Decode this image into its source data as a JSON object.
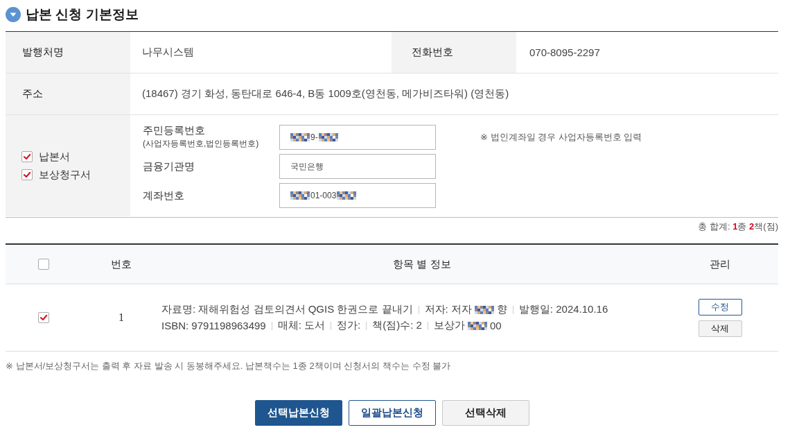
{
  "section": {
    "title": "납본 신청 기본정보"
  },
  "info_table": {
    "publisher_label": "발행처명",
    "publisher": "나무시스템",
    "phone_label": "전화번호",
    "phone": "070-8095-2297",
    "address_label": "주소",
    "address": "(18467) 경기 화성, 동탄대로 646-4, B동 1009호(영천동, 메가비즈타워) (영천동)",
    "documents": [
      {
        "label": "납본서",
        "checked": true
      },
      {
        "label": "보상청구서",
        "checked": true
      }
    ],
    "fields": [
      {
        "label": "주민등록번호",
        "sublabel": "(사업자등록번호,법인등록번호)",
        "value_parts": [
          {
            "kind": "masked"
          },
          {
            "kind": "text",
            "text": "9-"
          },
          {
            "kind": "masked"
          }
        ]
      },
      {
        "label": "금융기관명",
        "value_parts": [
          {
            "kind": "text",
            "text": "국민은행"
          }
        ]
      },
      {
        "label": "계좌번호",
        "value_parts": [
          {
            "kind": "masked"
          },
          {
            "kind": "text",
            "text": "01-003"
          },
          {
            "kind": "masked"
          }
        ]
      }
    ],
    "note": "※ 법인계좌일 경우 사업자등록번호 입력"
  },
  "total": "총 합계: **1**종 **2**책(점)",
  "items_table": {
    "columns": [
      {
        "kind": "checkbox",
        "checked": false
      },
      {
        "kind": "text",
        "label": "번호"
      },
      {
        "kind": "text",
        "label": "항목 별 정보"
      },
      {
        "kind": "text",
        "label": "관리"
      }
    ],
    "rows": [
      {
        "checked": true,
        "number": "1",
        "info_lines": [
          [
            {
              "parts": [
                {
                  "kind": "text",
                  "text": "자료명: 재해위험성 검토의견서 QGIS 한권으로 끝내기"
                }
              ]
            },
            {
              "parts": [
                {
                  "kind": "text",
                  "text": "저자: 저자"
                },
                {
                  "kind": "masked"
                },
                {
                  "kind": "text",
                  "text": "향"
                }
              ]
            },
            {
              "parts": [
                {
                  "kind": "text",
                  "text": "발행일: 2024.10.16"
                }
              ]
            }
          ],
          [
            {
              "parts": [
                {
                  "kind": "text",
                  "text": "ISBN: 9791198963499"
                }
              ]
            },
            {
              "parts": [
                {
                  "kind": "text",
                  "text": "매체: 도서"
                }
              ]
            },
            {
              "parts": [
                {
                  "kind": "text",
                  "text": "정가:"
                }
              ]
            },
            {
              "parts": [
                {
                  "kind": "text",
                  "text": "책(점)수: 2"
                }
              ]
            },
            {
              "parts": [
                {
                  "kind": "text",
                  "text": "보상가"
                },
                {
                  "kind": "masked"
                },
                {
                  "kind": "text",
                  "text": "00"
                }
              ]
            }
          ]
        ],
        "actions": [
          {
            "label": "수정",
            "kind": "outline"
          },
          {
            "label": "삭제",
            "kind": "gray"
          }
        ]
      }
    ]
  },
  "footnote": "※ 납본서/보상청구서는 출력 후 자료 발송 시 동봉해주세요. 납본책수는 1종 2책이며 신청서의 책수는 수정 불가",
  "buttons": [
    {
      "label": "선택납본신청",
      "kind": "primary"
    },
    {
      "label": "일괄납본신청",
      "kind": "outline"
    },
    {
      "label": "선택삭제",
      "kind": "gray"
    }
  ]
}
